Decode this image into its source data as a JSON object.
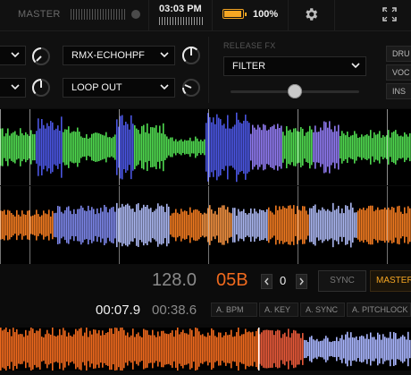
{
  "topbar": {
    "master_label": "MASTER",
    "clock": "03:03 PM",
    "battery_percent": "100%",
    "battery_level": 1.0,
    "icons": [
      "gear-icon",
      "fullscreen-icon"
    ]
  },
  "fx": {
    "left_top_value": "",
    "left_bottom_value": "",
    "effect_top": "RMX-ECHOHPF",
    "effect_bottom": "LOOP OUT",
    "release_label": "RELEASE FX",
    "release_value": "FILTER",
    "release_slider_level": 0.5,
    "right_buttons": [
      "DRU",
      "VOC",
      "INS"
    ]
  },
  "deck": {
    "bpm": "128.0",
    "key": "05B",
    "key_shift": "0",
    "sync_label": "SYNC",
    "master_label": "MASTER",
    "elapsed": "00:07.9",
    "remaining": "00:38.6",
    "auto_buttons": [
      "A. BPM",
      "A. KEY",
      "A. SYNC",
      "A. PITCHLOCK"
    ]
  },
  "colors": {
    "accent": "#f5a623",
    "key_color": "#f06a1e",
    "wave_green": "#4fd84f",
    "wave_blue": "#4a55e0",
    "wave_orange": "#f07a20"
  }
}
